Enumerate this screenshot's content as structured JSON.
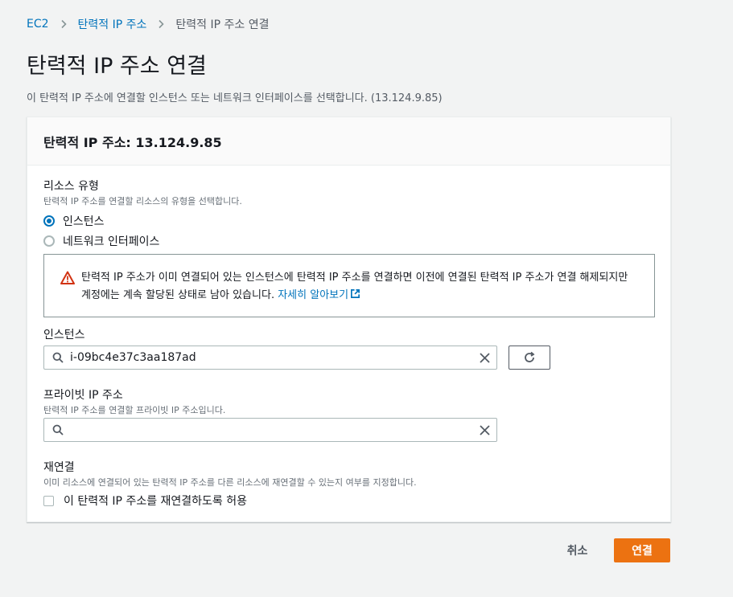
{
  "breadcrumb": {
    "items": [
      "EC2",
      "탄력적 IP 주소",
      "탄력적 IP 주소 연결"
    ]
  },
  "page": {
    "title": "탄력적 IP 주소 연결",
    "description": "이 탄력적 IP 주소에 연결할 인스턴스 또는 네트워크 인터페이스를 선택합니다. (13.124.9.85)"
  },
  "panel": {
    "title": "탄력적 IP 주소: 13.124.9.85"
  },
  "resource_type": {
    "label": "리소스 유형",
    "help": "탄력적 IP 주소를 연결할 리소스의 유형을 선택합니다.",
    "options": [
      "인스턴스",
      "네트워크 인터페이스"
    ],
    "selected": "인스턴스"
  },
  "alert": {
    "text": "탄력적 IP 주소가 이미 연결되어 있는 인스턴스에 탄력적 IP 주소를 연결하면 이전에 연결된 탄력적 IP 주소가 연결 해제되지만 계정에는 계속 할당된 상태로 남아 있습니다.",
    "link": "자세히 알아보기"
  },
  "instance": {
    "label": "인스턴스",
    "value": "i-09bc4e37c3aa187ad"
  },
  "private_ip": {
    "label": "프라이빗 IP 주소",
    "help": "탄력적 IP 주소를 연결할 프라이빗 IP 주소입니다.",
    "value": ""
  },
  "reassociation": {
    "label": "재연결",
    "help": "이미 리소스에 연결되어 있는 탄력적 IP 주소를 다른 리소스에 재연결할 수 있는지 여부를 지정합니다.",
    "checkbox_label": "이 탄력적 IP 주소를 재연결하도록 허용",
    "checked": false
  },
  "actions": {
    "cancel": "취소",
    "associate": "연결"
  },
  "colors": {
    "link": "#0073bb",
    "primary": "#ec7211",
    "warning": "#d13212"
  }
}
